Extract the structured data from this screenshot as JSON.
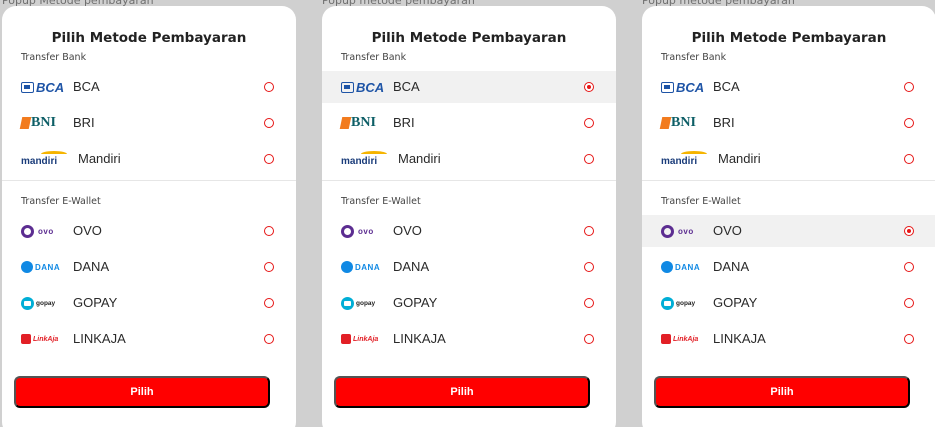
{
  "captions": [
    "Popup Metode pembayaran",
    "Popup metode pembayaran",
    "Popup metode pembayaran"
  ],
  "panels": [
    {
      "title": "Pilih Metode Pembayaran",
      "bank_section": "Transfer Bank",
      "ewallet_section": "Transfer E-Wallet",
      "banks": [
        {
          "logo_text": "BCA",
          "label": "BCA",
          "selected": false
        },
        {
          "logo_text": "BNI",
          "label": "BRI",
          "selected": false
        },
        {
          "logo_text": "mandiri",
          "label": "Mandiri",
          "selected": false
        }
      ],
      "ewallets": [
        {
          "logo_text": "ovo",
          "label": "OVO",
          "selected": false
        },
        {
          "logo_text": "DANA",
          "label": "DANA",
          "selected": false
        },
        {
          "logo_text": "gopay",
          "label": "GOPAY",
          "selected": false
        },
        {
          "logo_text": "LinkAja",
          "label": "LINKAJA",
          "selected": false
        }
      ],
      "button": "Pilih"
    },
    {
      "title": "Pilih Metode Pembayaran",
      "bank_section": "Transfer Bank",
      "ewallet_section": "Transfer E-Wallet",
      "banks": [
        {
          "logo_text": "BCA",
          "label": "BCA",
          "selected": true
        },
        {
          "logo_text": "BNI",
          "label": "BRI",
          "selected": false
        },
        {
          "logo_text": "mandiri",
          "label": "Mandiri",
          "selected": false
        }
      ],
      "ewallets": [
        {
          "logo_text": "ovo",
          "label": "OVO",
          "selected": false
        },
        {
          "logo_text": "DANA",
          "label": "DANA",
          "selected": false
        },
        {
          "logo_text": "gopay",
          "label": "GOPAY",
          "selected": false
        },
        {
          "logo_text": "LinkAja",
          "label": "LINKAJA",
          "selected": false
        }
      ],
      "button": "Pilih"
    },
    {
      "title": "Pilih Metode Pembayaran",
      "bank_section": "Transfer Bank",
      "ewallet_section": "Transfer E-Wallet",
      "banks": [
        {
          "logo_text": "BCA",
          "label": "BCA",
          "selected": false
        },
        {
          "logo_text": "BNI",
          "label": "BRI",
          "selected": false
        },
        {
          "logo_text": "mandiri",
          "label": "Mandiri",
          "selected": false
        }
      ],
      "ewallets": [
        {
          "logo_text": "ovo",
          "label": "OVO",
          "selected": true
        },
        {
          "logo_text": "DANA",
          "label": "DANA",
          "selected": false
        },
        {
          "logo_text": "gopay",
          "label": "GOPAY",
          "selected": false
        },
        {
          "logo_text": "LinkAja",
          "label": "LINKAJA",
          "selected": false
        }
      ],
      "button": "Pilih"
    }
  ],
  "colors": {
    "accent": "#ff0000",
    "radio": "#e61616",
    "selected_row": "#f1f1f1",
    "backdrop": "#d0d0d0"
  }
}
